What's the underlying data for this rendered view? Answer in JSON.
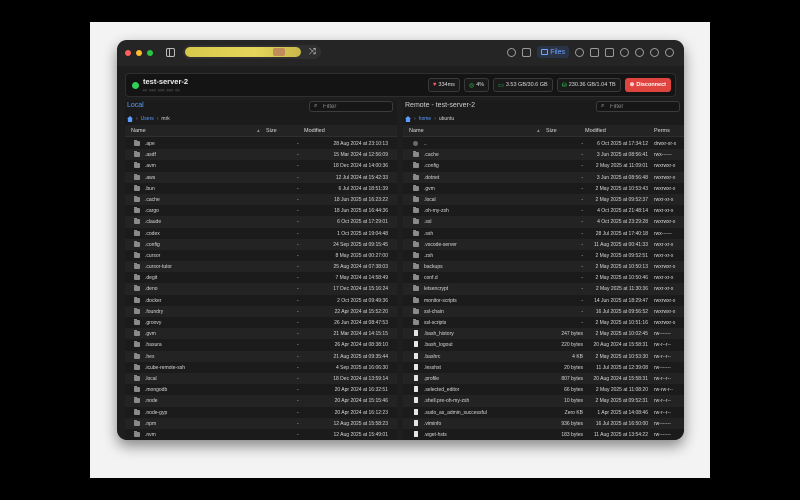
{
  "titlebar": {
    "files_label": "Files"
  },
  "host": {
    "name": "test-server-2",
    "address": "•• ••• ••• ••• ••",
    "latency": "334ms",
    "cpu": "4%",
    "memory": "3.53 GB/30.6 GB",
    "disk": "230.36 GB/1.04 TB",
    "disconnect_label": "Disconnect"
  },
  "left": {
    "title": "Local",
    "filter_placeholder": "Filter",
    "breadcrumb": [
      "Users",
      "mrk"
    ],
    "columns": {
      "name": "Name",
      "size": "Size",
      "modified": "Modified"
    },
    "rows": [
      {
        "name": ".ape",
        "size": "-",
        "modified": "28 Aug 2024 at 23:10:13"
      },
      {
        "name": ".asdf",
        "size": "-",
        "modified": "15 Mar 2024 at 12:56:09"
      },
      {
        "name": ".avm",
        "size": "-",
        "modified": "18 Dec 2024 at 14:00:36"
      },
      {
        "name": ".aws",
        "size": "-",
        "modified": "12 Jul 2024 at 15:42:33"
      },
      {
        "name": ".bun",
        "size": "-",
        "modified": "6 Jul 2024 at 18:51:39"
      },
      {
        "name": ".cache",
        "size": "-",
        "modified": "18 Jun 2025 at 16:23:22"
      },
      {
        "name": ".cargo",
        "size": "-",
        "modified": "18 Jun 2025 at 16:44:36"
      },
      {
        "name": ".claude",
        "size": "-",
        "modified": "6 Oct 2025 at 17:29:01"
      },
      {
        "name": ".codex",
        "size": "-",
        "modified": "1 Oct 2025 at 19:04:48"
      },
      {
        "name": ".config",
        "size": "-",
        "modified": "24 Sep 2025 at 09:15:45"
      },
      {
        "name": ".cursor",
        "size": "-",
        "modified": "8 May 2025 at 00:27:00"
      },
      {
        "name": ".cursor-tutor",
        "size": "-",
        "modified": "25 Aug 2024 at 07:38:03"
      },
      {
        "name": ".degit",
        "size": "-",
        "modified": "7 May 2024 at 14:58:49"
      },
      {
        "name": ".deno",
        "size": "-",
        "modified": "17 Dec 2024 at 15:16:24"
      },
      {
        "name": ".docker",
        "size": "-",
        "modified": "2 Oct 2025 at 09:49:36"
      },
      {
        "name": ".foundry",
        "size": "-",
        "modified": "22 Apr 2024 at 15:52:20"
      },
      {
        "name": ".groovy",
        "size": "-",
        "modified": "26 Jun 2024 at 08:47:53"
      },
      {
        "name": ".gvm",
        "size": "-",
        "modified": "21 Mar 2024 at 14:15:15"
      },
      {
        "name": ".hasura",
        "size": "-",
        "modified": "26 Apr 2024 at 08:38:10"
      },
      {
        "name": ".hex",
        "size": "-",
        "modified": "21 Aug 2025 at 09:35:44"
      },
      {
        "name": ".icube-remote-ssh",
        "size": "-",
        "modified": "4 Sep 2025 at 16:06:30"
      },
      {
        "name": ".local",
        "size": "-",
        "modified": "18 Dec 2024 at 13:59:14"
      },
      {
        "name": ".mongodb",
        "size": "-",
        "modified": "20 Apr 2024 at 16:32:51"
      },
      {
        "name": ".node",
        "size": "-",
        "modified": "20 Apr 2024 at 15:15:46"
      },
      {
        "name": ".node-gyp",
        "size": "-",
        "modified": "20 Apr 2024 at 16:12:23"
      },
      {
        "name": ".npm",
        "size": "-",
        "modified": "12 Aug 2025 at 15:58:23"
      },
      {
        "name": ".nvm",
        "size": "-",
        "modified": "12 Aug 2025 at 15:49:01"
      }
    ]
  },
  "right": {
    "title": "Remote - test-server-2",
    "filter_placeholder": "Filter",
    "breadcrumb": [
      "home",
      "ubuntu"
    ],
    "columns": {
      "name": "Name",
      "size": "Size",
      "modified": "Modified",
      "perms": "Perms"
    },
    "rows": [
      {
        "type": "up",
        "name": "..",
        "size": "-",
        "modified": "6 Oct 2025 at 17:34:12",
        "perms": "drwxr-xr-x"
      },
      {
        "type": "folder",
        "name": ".cache",
        "size": "-",
        "modified": "3 Jun 2025 at 08:56:41",
        "perms": "rwx------"
      },
      {
        "type": "folder",
        "name": ".config",
        "size": "-",
        "modified": "2 May 2025 at 11:09:01",
        "perms": "rwxrwxr-x"
      },
      {
        "type": "folder",
        "name": ".dotnet",
        "size": "-",
        "modified": "3 Jun 2025 at 08:56:48",
        "perms": "rwxrwxr-x"
      },
      {
        "type": "folder",
        "name": ".gvm",
        "size": "-",
        "modified": "2 May 2025 at 10:53:43",
        "perms": "rwxrwxr-x"
      },
      {
        "type": "folder",
        "name": ".local",
        "size": "-",
        "modified": "2 May 2025 at 09:52:37",
        "perms": "rwxr-xr-x"
      },
      {
        "type": "folder",
        "name": ".oh-my-zsh",
        "size": "-",
        "modified": "4 Oct 2025 at 21:48:14",
        "perms": "rwxr-xr-x"
      },
      {
        "type": "folder",
        "name": ".ssl",
        "size": "-",
        "modified": "4 Oct 2025 at 23:29:28",
        "perms": "rwxrwxr-x"
      },
      {
        "type": "folder",
        "name": ".ssh",
        "size": "-",
        "modified": "28 Jul 2025 at 17:40:18",
        "perms": "rwx------"
      },
      {
        "type": "folder",
        "name": ".vscode-server",
        "size": "-",
        "modified": "11 Aug 2025 at 00:41:33",
        "perms": "rwxr-xr-x"
      },
      {
        "type": "folder",
        "name": ".zsh",
        "size": "-",
        "modified": "2 May 2025 at 09:52:51",
        "perms": "rwxr-xr-x"
      },
      {
        "type": "folder",
        "name": "backups",
        "size": "-",
        "modified": "2 May 2025 at 10:50:13",
        "perms": "rwxrwxr-x"
      },
      {
        "type": "folder",
        "name": "conf.d",
        "size": "-",
        "modified": "2 May 2025 at 10:50:46",
        "perms": "rwxr-xr-x"
      },
      {
        "type": "folder",
        "name": "letsencrypt",
        "size": "-",
        "modified": "2 May 2025 at 11:30:36",
        "perms": "rwxr-xr-x"
      },
      {
        "type": "folder",
        "name": "monitor-scripts",
        "size": "-",
        "modified": "14 Jun 2025 at 18:29:47",
        "perms": "rwxrwxr-x"
      },
      {
        "type": "folder",
        "name": "ssl-chain",
        "size": "-",
        "modified": "16 Jul 2025 at 09:56:52",
        "perms": "rwxrwxr-x"
      },
      {
        "type": "folder",
        "name": "ssl-scripts",
        "size": "-",
        "modified": "2 May 2025 at 10:51:16",
        "perms": "rwxrwxr-x"
      },
      {
        "type": "file",
        "name": ".bash_history",
        "size": "247 bytes",
        "modified": "2 May 2025 at 10:02:45",
        "perms": "rw-------"
      },
      {
        "type": "file",
        "name": ".bash_logout",
        "size": "220 bytes",
        "modified": "20 Aug 2024 at 15:58:31",
        "perms": "rw-r--r--"
      },
      {
        "type": "file",
        "name": ".bashrc",
        "size": "4 KB",
        "modified": "2 May 2025 at 10:53:30",
        "perms": "rw-r--r--"
      },
      {
        "type": "file",
        "name": ".lesshst",
        "size": "20 bytes",
        "modified": "11 Jul 2025 at 12:39:08",
        "perms": "rw-------"
      },
      {
        "type": "file",
        "name": ".profile",
        "size": "807 bytes",
        "modified": "20 Aug 2024 at 15:58:31",
        "perms": "rw-r--r--"
      },
      {
        "type": "file",
        "name": ".selected_editor",
        "size": "66 bytes",
        "modified": "2 May 2025 at 11:08:20",
        "perms": "rw-rw-r--"
      },
      {
        "type": "file",
        "name": ".shell.pre-oh-my-zsh",
        "size": "10 bytes",
        "modified": "2 May 2025 at 09:52:31",
        "perms": "rw-r--r--"
      },
      {
        "type": "file",
        "name": ".sudo_as_admin_successful",
        "size": "Zero KB",
        "modified": "1 Apr 2025 at 14:08:46",
        "perms": "rw-r--r--"
      },
      {
        "type": "file",
        "name": ".viminfo",
        "size": "936 bytes",
        "modified": "16 Jul 2025 at 16:50:00",
        "perms": "rw-------"
      },
      {
        "type": "file",
        "name": ".wget-hsts",
        "size": "183 bytes",
        "modified": "11 Aug 2025 at 13:54:22",
        "perms": "rw-------"
      }
    ]
  }
}
